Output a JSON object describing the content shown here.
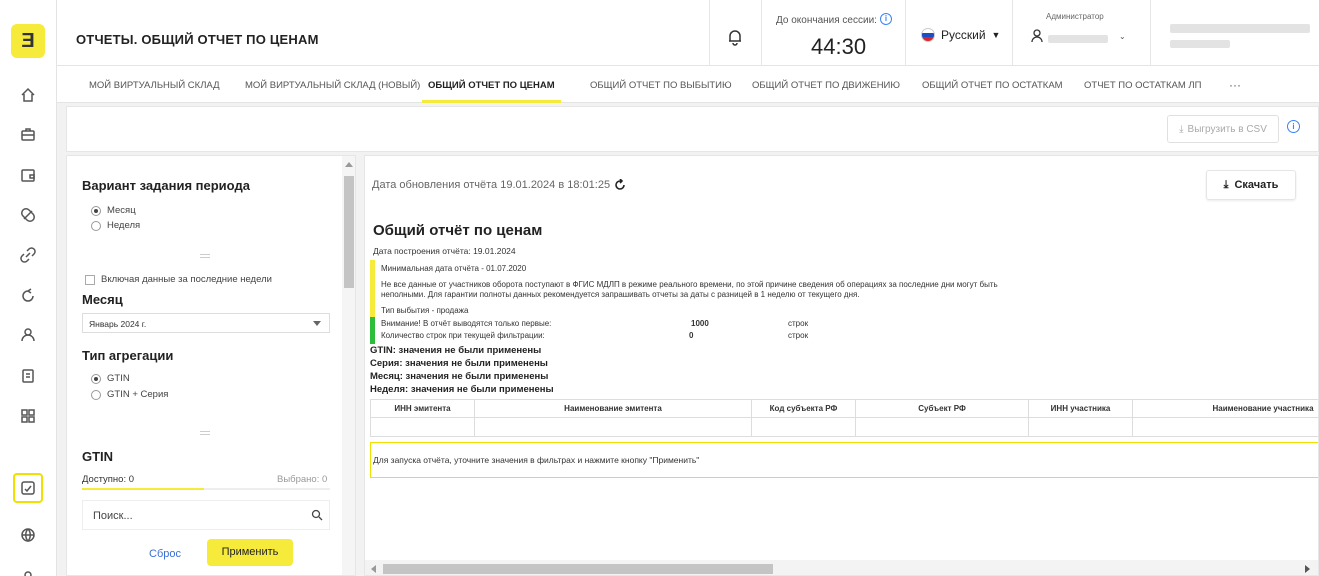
{
  "app": {
    "logo_glyph": "Ǝ",
    "accent": "#f6ea3b"
  },
  "header": {
    "title": "ОТЧЕТЫ. ОБЩИЙ ОТЧЕТ ПО ЦЕНАМ",
    "session_label": "До окончания сессии:",
    "session_time": "44:30",
    "language": "Русский",
    "user_role": "Администратор"
  },
  "tabs": [
    {
      "label": "МОЙ ВИРТУАЛЬНЫЙ СКЛАД"
    },
    {
      "label": "МОЙ ВИРТУАЛЬНЫЙ СКЛАД (НОВЫЙ)"
    },
    {
      "label": "ОБЩИЙ ОТЧЕТ ПО ЦЕНАМ",
      "active": true
    },
    {
      "label": "ОБЩИЙ ОТЧЕТ ПО ВЫБЫТИЮ"
    },
    {
      "label": "ОБЩИЙ ОТЧЕТ ПО ДВИЖЕНИЮ"
    },
    {
      "label": "ОБЩИЙ ОТЧЕТ ПО ОСТАТКАМ"
    },
    {
      "label": "ОТЧЕТ ПО ОСТАТКАМ ЛП"
    },
    {
      "label": "···"
    }
  ],
  "toolbar": {
    "csv_label": "Выгрузить в CSV"
  },
  "filters": {
    "period_title": "Вариант задания периода",
    "period_options": [
      "Месяц",
      "Неделя"
    ],
    "period_selected": "Месяц",
    "include_weeks_label": "Включая данные за последние недели",
    "month_title": "Месяц",
    "month_value": "Январь 2024 г.",
    "agg_title": "Тип агрегации",
    "agg_options": [
      "GTIN",
      "GTIN + Серия"
    ],
    "agg_selected": "GTIN",
    "gtin_title": "GTIN",
    "available": "Доступно: 0",
    "selected": "Выбрано: 0",
    "search_placeholder": "Поиск...",
    "reset_label": "Сброс",
    "apply_label": "Применить"
  },
  "report": {
    "update_text": "Дата обновления отчёта 19.01.2024 в 18:01:25",
    "download_label": "Скачать",
    "title": "Общий отчёт по ценам",
    "built": "Дата построения отчёта: 19.01.2024",
    "min_date": "Минимальная дата отчёта - 01.07.2020",
    "warning_1": "Не все данные от участников оборота поступают в ФГИС МДЛП в режиме реального времени, по этой причине сведения об операциях за последние дни могут быть",
    "warning_2": "неполными. Для гарантии полноты данных рекомендуется запрашивать отчеты за даты с разницей в 1 неделю от текущего дня.",
    "exit_type": "Тип выбытия - продажа",
    "limit_label": "Внимание! В отчёт выводятся только первые:",
    "limit_value": "1000",
    "limit_unit": "строк",
    "count_label": "Количество строк при текущей фильтрации:",
    "count_value": "0",
    "count_unit": "строк",
    "applied": [
      "GTIN: значения не были применены",
      "Серия: значения не были применены",
      "Месяц: значения не были применены",
      "Неделя: значения не были применены"
    ],
    "columns": [
      "ИНН эмитента",
      "Наименование эмитента",
      "Код субъекта РФ",
      "Субъект РФ",
      "ИНН участника",
      "Наименование участника"
    ],
    "empty_notice": "Для запуска отчёта, уточните значения в фильтрах и нажмите кнопку \"Применить\""
  }
}
